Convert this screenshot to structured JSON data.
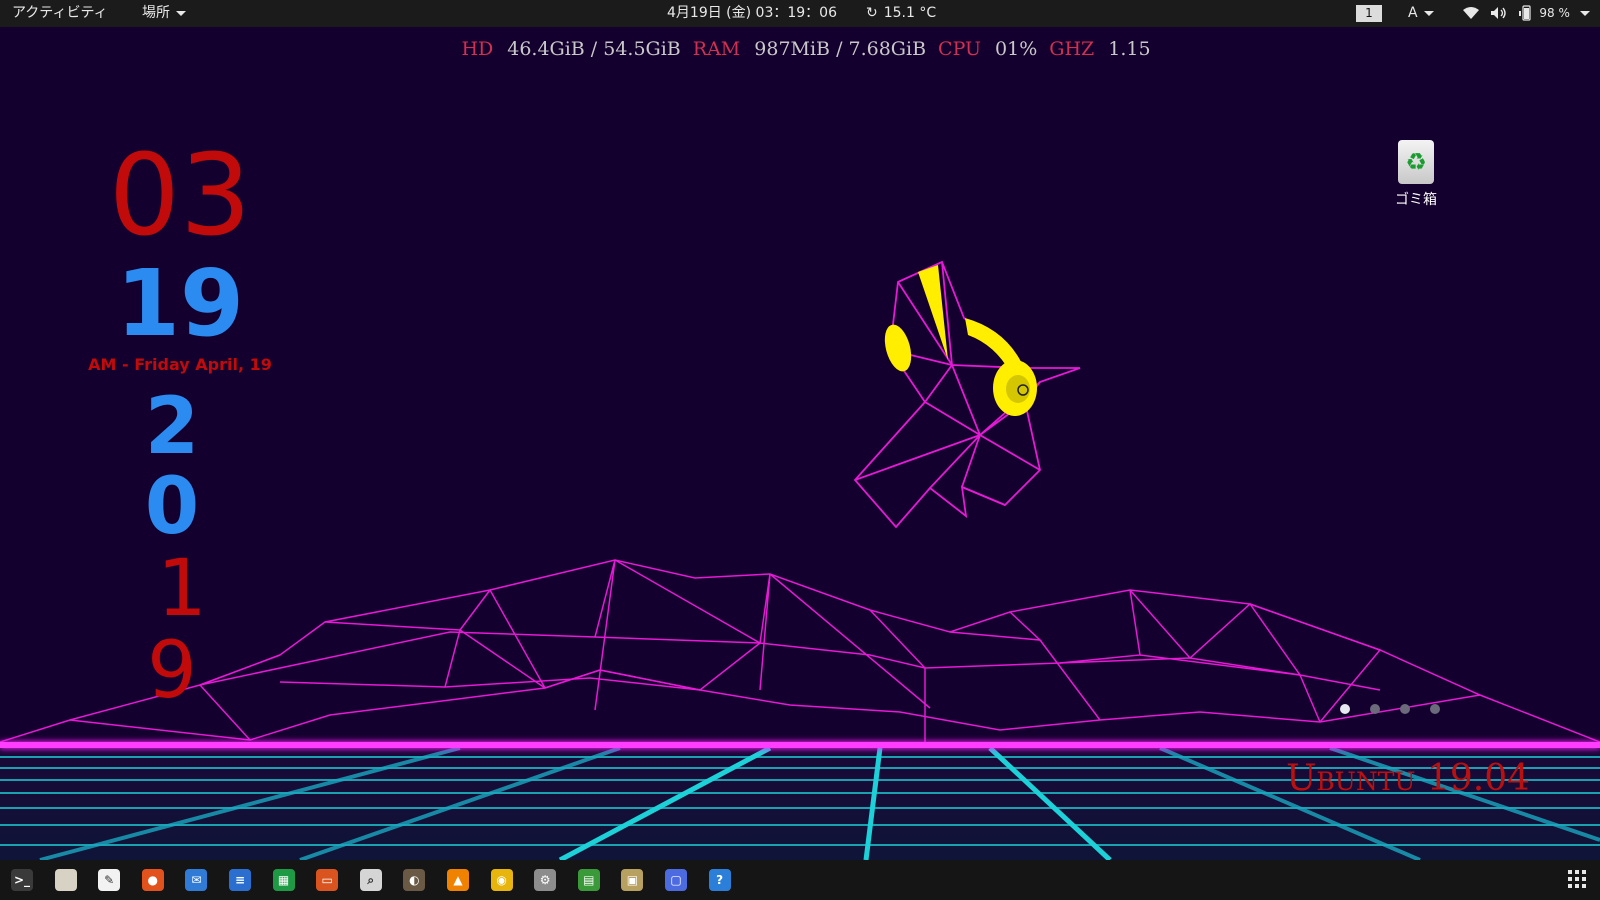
{
  "topbar": {
    "activities": "アクティビティ",
    "places": "場所",
    "datetime": "4月19日 (金)  03：19：06",
    "weather": "15.1 °C",
    "workspace": "1",
    "input_method": "A",
    "battery": "98 %"
  },
  "conky": [
    {
      "label": "HD",
      "value": "46.4GiB / 54.5GiB"
    },
    {
      "label": "RAM",
      "value": "987MiB / 7.68GiB"
    },
    {
      "label": "CPU",
      "value": "01%"
    },
    {
      "label": "GHZ",
      "value": "1.15"
    }
  ],
  "clock": {
    "hour": "03",
    "minute": "19",
    "date_line": "AM - Friday April, 19",
    "year_digits": [
      "2",
      "0",
      "1",
      "9"
    ]
  },
  "desktop": {
    "trash_label": "ゴミ箱",
    "brand_text": "Ubuntu 19.04",
    "page_dots_count": 4,
    "page_dots_active": 1
  },
  "dock": {
    "apps": [
      {
        "name": "terminal-icon",
        "color": "#3a3a3a",
        "glyph": ">_"
      },
      {
        "name": "files-icon",
        "color": "#d8d2c4",
        "glyph": ""
      },
      {
        "name": "text-editor-icon",
        "color": "#f2f2f2",
        "glyph": "✎"
      },
      {
        "name": "firefox-icon",
        "color": "#e2521d",
        "glyph": "●"
      },
      {
        "name": "thunderbird-icon",
        "color": "#2f7bd6",
        "glyph": "✉"
      },
      {
        "name": "writer-icon",
        "color": "#2a6fd0",
        "glyph": "≡"
      },
      {
        "name": "calc-icon",
        "color": "#1f9a44",
        "glyph": "▦"
      },
      {
        "name": "impress-icon",
        "color": "#d9541f",
        "glyph": "▭"
      },
      {
        "name": "image-viewer-icon",
        "color": "#d5d5d5",
        "glyph": "⌕"
      },
      {
        "name": "gimp-icon",
        "color": "#6a5a45",
        "glyph": "◐"
      },
      {
        "name": "vlc-icon",
        "color": "#ef8200",
        "glyph": "▲"
      },
      {
        "name": "rhythmbox-icon",
        "color": "#e8b50f",
        "glyph": "◉"
      },
      {
        "name": "settings-icon",
        "color": "#8d8d8d",
        "glyph": "⚙"
      },
      {
        "name": "system-monitor-icon",
        "color": "#3a9a3a",
        "glyph": "▤"
      },
      {
        "name": "archive-icon",
        "color": "#b8a060",
        "glyph": "▣"
      },
      {
        "name": "screenshot-icon",
        "color": "#4d6be0",
        "glyph": "▢"
      },
      {
        "name": "help-icon",
        "color": "#2b7fd8",
        "glyph": "?"
      }
    ]
  },
  "colors": {
    "bg": "#14002e",
    "hour": "#c10a0a",
    "minute": "#2b8bf0",
    "date_line": "#c10a0a",
    "grid_cyan": "#1dd1d8",
    "mountain_magenta": "#e619d6",
    "horizon": "#ff1cff",
    "headphones": "#ffee00"
  }
}
